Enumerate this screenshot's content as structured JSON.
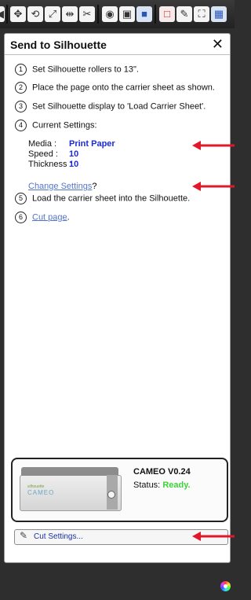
{
  "panel": {
    "title": "Send to Silhouette",
    "close_glyph": "✕"
  },
  "steps": [
    {
      "num": "1",
      "text": "Set Silhouette rollers to 13\"."
    },
    {
      "num": "2",
      "text": "Place the page onto the carrier sheet as shown."
    },
    {
      "num": "3",
      "text": "Set Silhouette display to 'Load Carrier Sheet'."
    },
    {
      "num": "4",
      "text": "Current Settings:"
    },
    {
      "num": "5",
      "text": "Load the carrier sheet into the Silhouette."
    },
    {
      "num": "6",
      "text": "Cut page",
      "suffix": "."
    }
  ],
  "current_settings": [
    {
      "label": "Media :",
      "value": "Print Paper"
    },
    {
      "label": "Speed :",
      "value": "10"
    },
    {
      "label": "Thickness :",
      "value": "10"
    }
  ],
  "change_settings": {
    "link": "Change Settings",
    "suffix": "?"
  },
  "device": {
    "name": "CAMEO V0.24",
    "status_label": "Status:",
    "status_value": "Ready.",
    "brand_small": "silhouette",
    "brand_logo": "CAMEO"
  },
  "cut_settings": {
    "label": "Cut Settings..."
  },
  "toolbar_icons": [
    "arrow-left-icon",
    "move-icon",
    "rotate-icon",
    "scale-icon",
    "flip-icon",
    "weld-icon",
    "edit-image-icon",
    "send-page-icon",
    "fill-icon",
    "rect-select-icon",
    "pencil-icon",
    "fullscreen-icon",
    "grid-icon"
  ],
  "colors": {
    "setting_value": "#1c2bd6",
    "link": "#5575c8",
    "ready": "#3fd13a",
    "annotation_arrow": "#e0182a"
  }
}
